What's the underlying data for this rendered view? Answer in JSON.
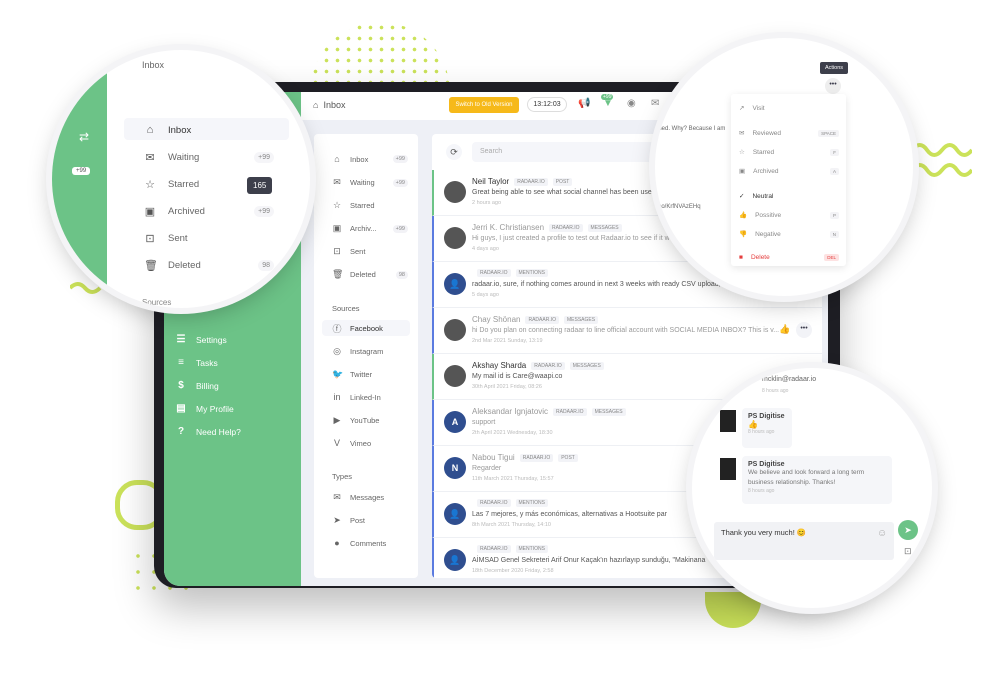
{
  "topbar": {
    "title": "Inbox",
    "switch_label": "Switch to Old Version",
    "clock": "13:12:03",
    "notif_badge": "+99"
  },
  "green_sidebar": {
    "badge": "+99",
    "items": [
      {
        "icon": "sliders-icon",
        "label": "Settings"
      },
      {
        "icon": "list-icon",
        "label": "Tasks"
      },
      {
        "icon": "dollar-icon",
        "label": "Billing"
      },
      {
        "icon": "id-card-icon",
        "label": "My Profile"
      },
      {
        "icon": "question-icon",
        "label": "Need Help?"
      }
    ]
  },
  "folders": [
    {
      "label": "Inbox",
      "badge": "+99",
      "icon": "inbox-icon"
    },
    {
      "label": "Waiting",
      "badge": "+99",
      "icon": "envelope-icon"
    },
    {
      "label": "Starred",
      "badge": "",
      "icon": "star-icon"
    },
    {
      "label": "Archiv...",
      "badge": "+99",
      "icon": "archive-icon"
    },
    {
      "label": "Sent",
      "badge": "",
      "icon": "sent-icon"
    },
    {
      "label": "Deleted",
      "badge": "98",
      "icon": "trash-icon"
    }
  ],
  "sources": {
    "heading": "Sources",
    "items": [
      "Facebook",
      "Instagram",
      "Twitter",
      "Linked-In",
      "YouTube",
      "Vimeo"
    ]
  },
  "types": {
    "heading": "Types",
    "items": [
      "Messages",
      "Post",
      "Comments"
    ]
  },
  "search": {
    "placeholder": "Search"
  },
  "feed": [
    {
      "name": "Neil Taylor",
      "tags": [
        "RADAAR.IO",
        "POST"
      ],
      "text": "Great being able to see what social channel has been used o",
      "time": "2 hours ago",
      "av": ""
    },
    {
      "name": "Jerri K. Christiansen",
      "tags": [
        "RADAAR.IO",
        "MESSAGES"
      ],
      "text": "Hi guys, I just created a profile to test out Radaar.io to see if it would",
      "time": "4 days ago",
      "av": ""
    },
    {
      "name": "",
      "tags": [
        "RADAAR.IO",
        "MENTIONS"
      ],
      "text": "radaar.io, sure, if nothing comes around in next 3 weeks with ready CSV upload, month",
      "time": "5 days ago",
      "av": "👤"
    },
    {
      "name": "Chay Shönan",
      "tags": [
        "RADAAR.IO",
        "MESSAGES"
      ],
      "text": "hi Do you plan on connecting radaar to line official account with SOCIAL MEDIA INBOX? This is v...",
      "time": "2nd Mar 2021 Sunday, 13:19",
      "av": ""
    },
    {
      "name": "Akshay Sharda",
      "tags": [
        "RADAAR.IO",
        "MESSAGES"
      ],
      "text": "My mail id is Care@waapi.co",
      "time": "30th April 2021 Friday, 08:26",
      "av": ""
    },
    {
      "name": "Aleksandar Ignjatovic",
      "tags": [
        "RADAAR.IO",
        "MESSAGES"
      ],
      "text": "support",
      "time": "2th April 2021 Wednesday, 18:30",
      "av": "A"
    },
    {
      "name": "Nabou Tigui",
      "tags": [
        "RADAAR.IO",
        "POST"
      ],
      "text": "Regarder",
      "time": "11th March 2021 Thursday, 15:57",
      "av": "N"
    },
    {
      "name": "",
      "tags": [
        "RADAAR.IO",
        "MENTIONS"
      ],
      "text": "Las 7 mejores, y más económicas, alternativas a Hootsuite par",
      "time": "8th March 2021 Thursday, 14:10",
      "av": "👤"
    },
    {
      "name": "",
      "tags": [
        "RADAAR.IO",
        "MENTIONS"
      ],
      "text": "AİMSAD Genel Sekreteri Arif Onur Kaçak'ın hazırlayıp sunduğu, \"Makinana",
      "time": "18th December 2020 Friday, 2:58",
      "av": "👤"
    }
  ],
  "magnifier_left": {
    "title": "Inbox",
    "tooltip": "165",
    "items": [
      {
        "label": "Inbox",
        "badge": ""
      },
      {
        "label": "Waiting",
        "badge": "+99"
      },
      {
        "label": "Starred",
        "badge": ""
      },
      {
        "label": "Archived",
        "badge": "+99"
      },
      {
        "label": "Sent",
        "badge": ""
      },
      {
        "label": "Deleted",
        "badge": "98"
      }
    ],
    "footer": "Sources"
  },
  "actions_menu": {
    "tooltip": "Actions",
    "partial_text": "ahed. Why? Because I am",
    "partial_link": "t.co/KrfNVAzEHq",
    "items": [
      {
        "label": "Visit",
        "key": ""
      },
      {
        "label": "Reviewed",
        "key": "SPACE"
      },
      {
        "label": "Starred",
        "key": "F"
      },
      {
        "label": "Archived",
        "key": "A"
      },
      {
        "label": "Neutral",
        "key": ""
      },
      {
        "label": "Possitive",
        "key": "P"
      },
      {
        "label": "Negative",
        "key": "N"
      },
      {
        "label": "Delete",
        "key": "DEL"
      }
    ]
  },
  "chat": {
    "top_email": "mcklin@radaar.io",
    "top_time": "8 hours ago",
    "messages": [
      {
        "author": "PS Digitise",
        "text": "👍",
        "time": "8 hours ago"
      },
      {
        "author": "PS Digitise",
        "text": "We believe and look forward a long term business relationship. Thanks!",
        "time": "8 hours ago"
      }
    ],
    "composer_value": "Thank you very much! 😊"
  }
}
